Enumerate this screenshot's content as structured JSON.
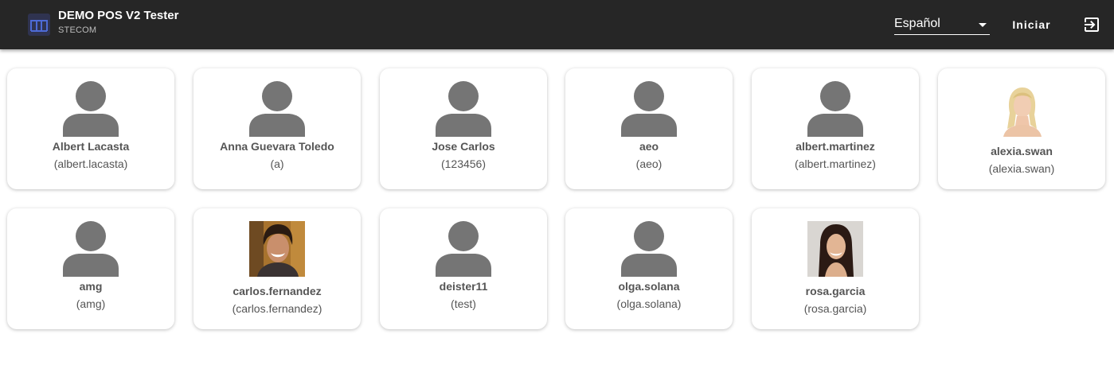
{
  "header": {
    "title": "DEMO POS V2 Tester",
    "subtitle": "STECOM",
    "language": "Español",
    "login_label": "Iniciar",
    "logo_icon": "app-logo-icon",
    "exit_icon": "exit-icon"
  },
  "users": [
    {
      "name": "Albert Lacasta",
      "login": "(albert.lacasta)",
      "photo": "generic"
    },
    {
      "name": "Anna Guevara Toledo",
      "login": "(a)",
      "photo": "generic"
    },
    {
      "name": "Jose Carlos",
      "login": "(123456)",
      "photo": "generic"
    },
    {
      "name": "aeo",
      "login": "(aeo)",
      "photo": "generic"
    },
    {
      "name": "albert.martinez",
      "login": "(albert.martinez)",
      "photo": "generic"
    },
    {
      "name": "alexia.swan",
      "login": "(alexia.swan)",
      "photo": "blonde-woman-photo"
    },
    {
      "name": "amg",
      "login": "(amg)",
      "photo": "generic"
    },
    {
      "name": "carlos.fernandez",
      "login": "(carlos.fernandez)",
      "photo": "smiling-man-photo"
    },
    {
      "name": "deister11",
      "login": "(test)",
      "photo": "generic"
    },
    {
      "name": "olga.solana",
      "login": "(olga.solana)",
      "photo": "generic"
    },
    {
      "name": "rosa.garcia",
      "login": "(rosa.garcia)",
      "photo": "dark-haired-woman-photo"
    }
  ],
  "colors": {
    "topbar": "#262626",
    "avatar": "#757575",
    "text": "#555555"
  }
}
